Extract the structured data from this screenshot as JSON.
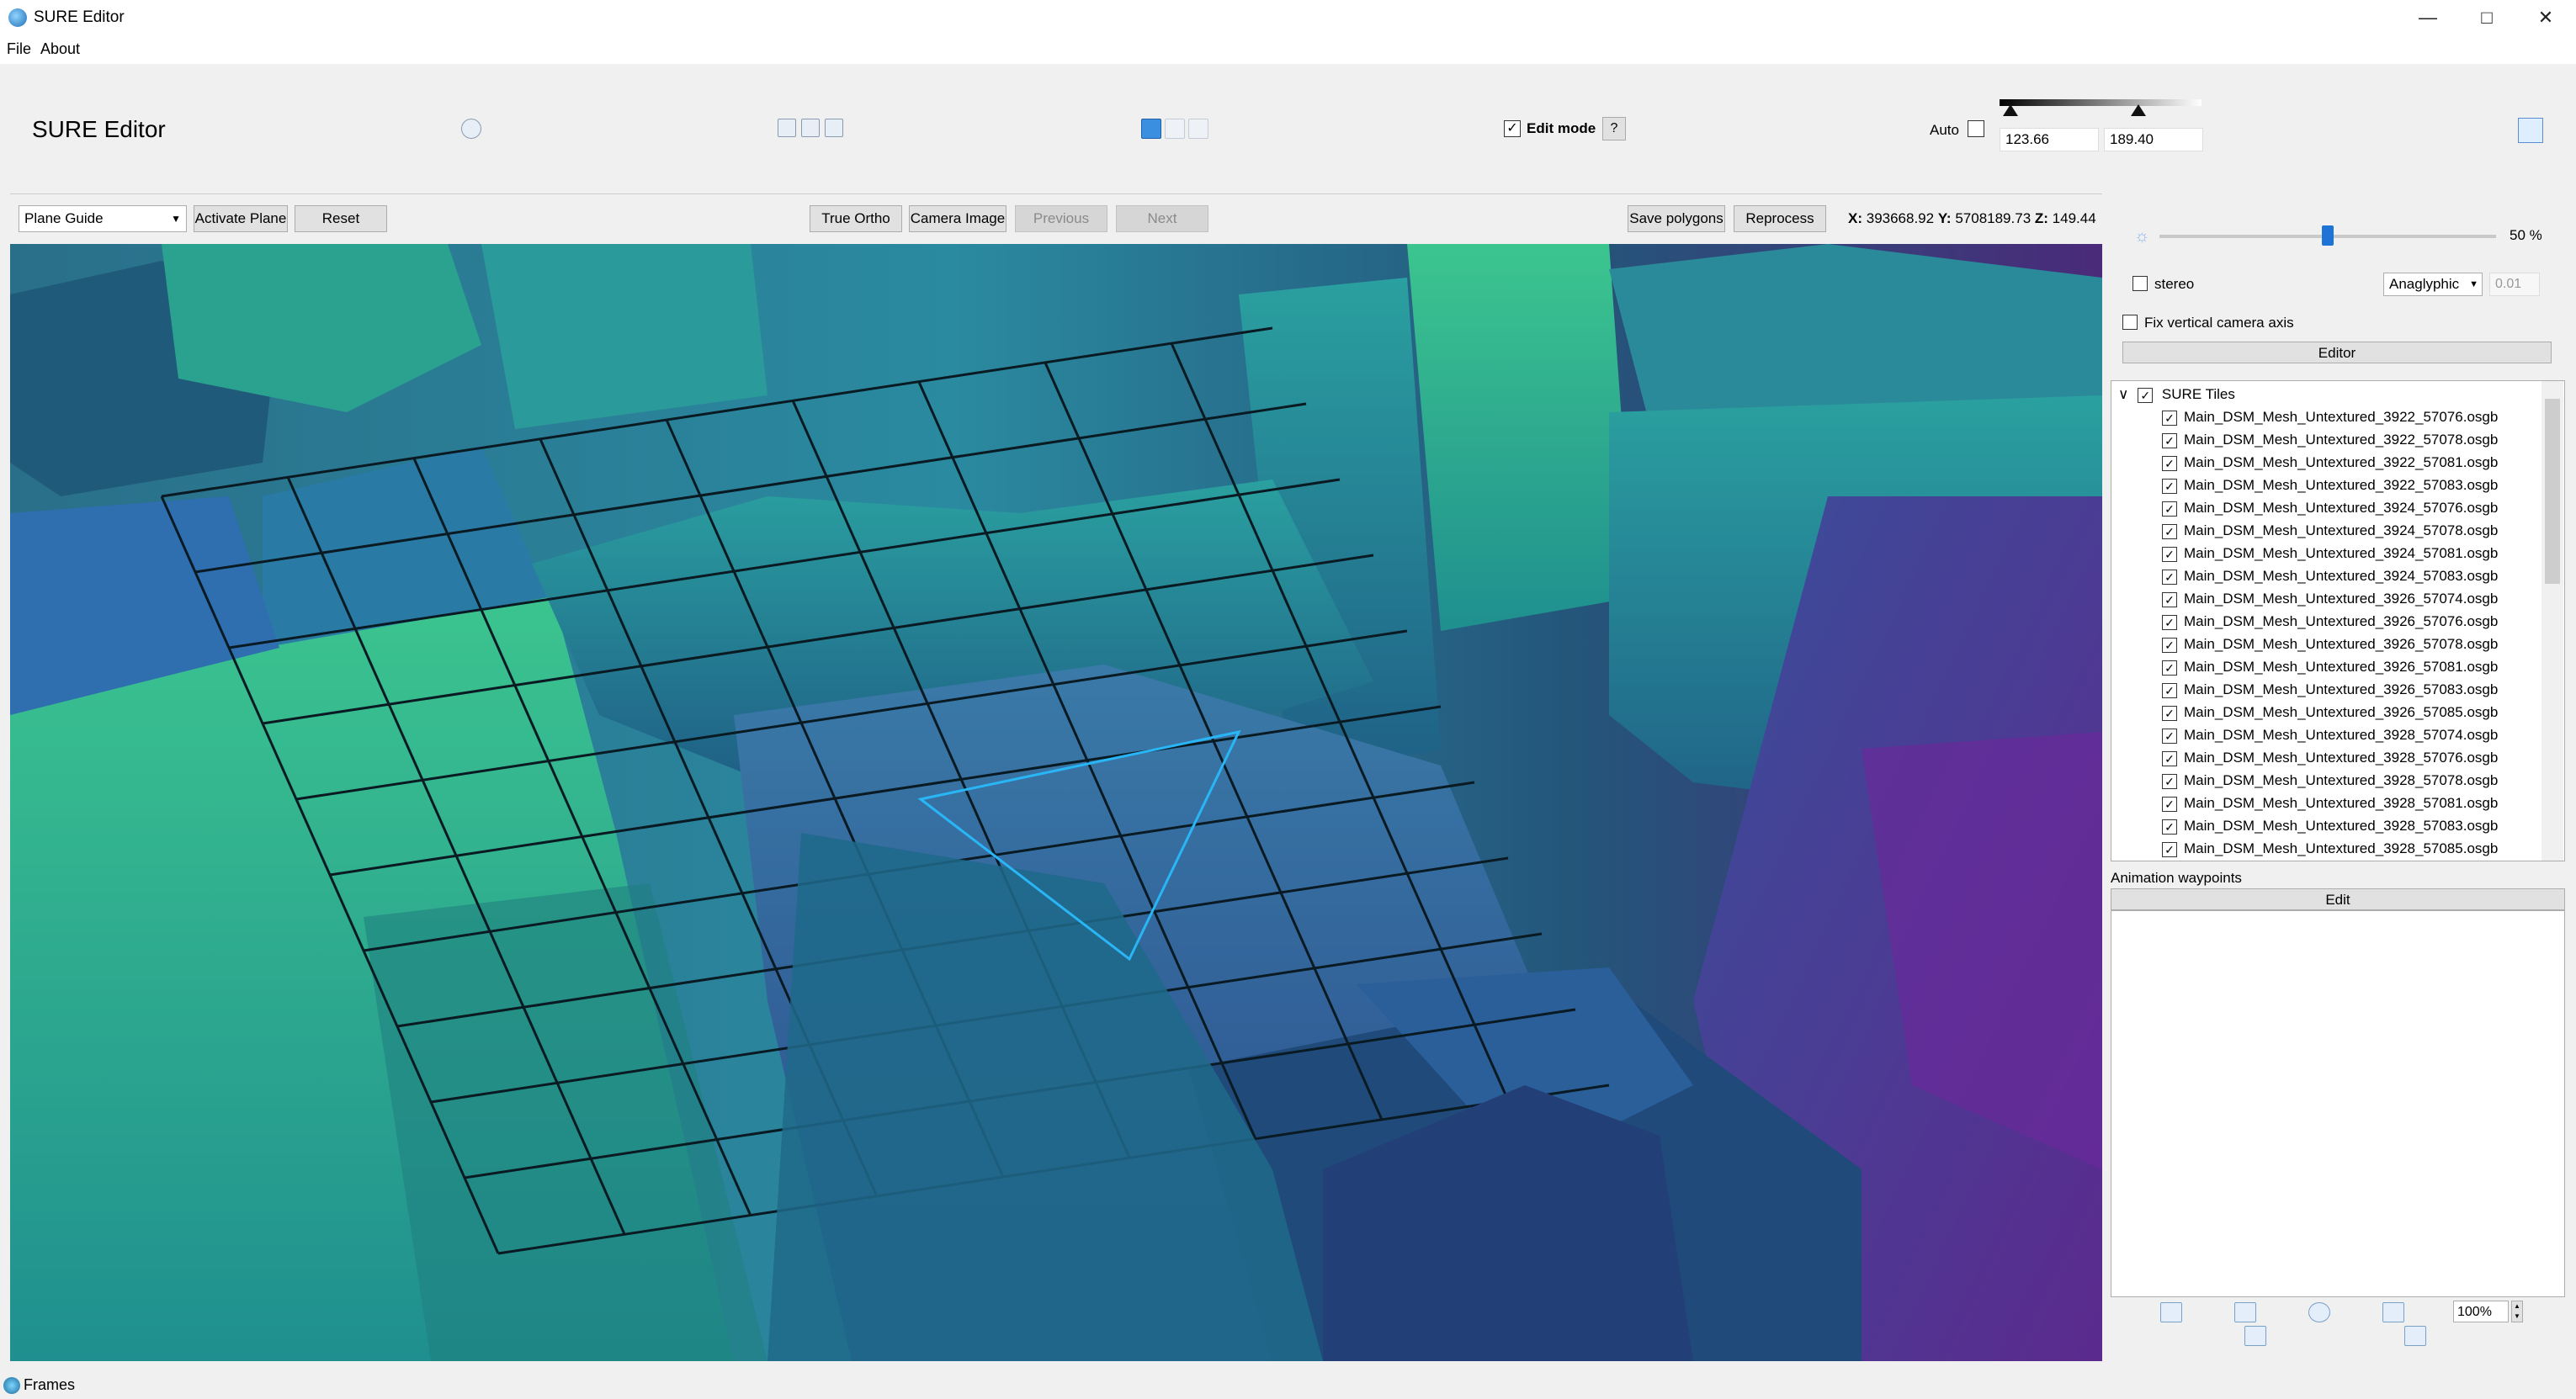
{
  "window": {
    "title": "SURE Editor",
    "minimize_icon": "minimize-icon",
    "maximize_icon": "maximize-icon",
    "close_icon": "close-icon"
  },
  "menu": {
    "items": [
      "File",
      "About"
    ]
  },
  "header": {
    "title": "SURE Editor",
    "help_icon": "help-icon",
    "edit_mode_label": "Edit mode",
    "edit_mode_checked": true,
    "edit_help_label": "?",
    "auto_label": "Auto",
    "auto_checked": false,
    "range_min": "123.66",
    "range_max": "189.40"
  },
  "viewer_toolbar": {
    "guide_select": "Plane Guide",
    "activate_plane": "Activate Plane",
    "reset": "Reset",
    "true_ortho": "True Ortho",
    "camera_image": "Camera Image",
    "previous": "Previous",
    "next": "Next",
    "save_polygons": "Save polygons",
    "reprocess": "Reprocess",
    "coords": {
      "x_label": "X:",
      "x": "393668.92",
      "y_label": "Y:",
      "y": "5708189.73",
      "z_label": "Z:",
      "z": "149.44"
    }
  },
  "right_panel": {
    "brightness_value": "50 %",
    "brightness_level": 0.5,
    "stereo_label": "stereo",
    "stereo_checked": false,
    "stereo_mode": "Anaglyphic",
    "stereo_offset": "0.01",
    "fix_axis_label": "Fix vertical camera axis",
    "fix_axis_checked": false,
    "editor_dropdown": "Editor",
    "tree": {
      "root": "SURE Tiles",
      "items": [
        "Main_DSM_Mesh_Untextured_3922_57076.osgb",
        "Main_DSM_Mesh_Untextured_3922_57078.osgb",
        "Main_DSM_Mesh_Untextured_3922_57081.osgb",
        "Main_DSM_Mesh_Untextured_3922_57083.osgb",
        "Main_DSM_Mesh_Untextured_3924_57076.osgb",
        "Main_DSM_Mesh_Untextured_3924_57078.osgb",
        "Main_DSM_Mesh_Untextured_3924_57081.osgb",
        "Main_DSM_Mesh_Untextured_3924_57083.osgb",
        "Main_DSM_Mesh_Untextured_3926_57074.osgb",
        "Main_DSM_Mesh_Untextured_3926_57076.osgb",
        "Main_DSM_Mesh_Untextured_3926_57078.osgb",
        "Main_DSM_Mesh_Untextured_3926_57081.osgb",
        "Main_DSM_Mesh_Untextured_3926_57083.osgb",
        "Main_DSM_Mesh_Untextured_3926_57085.osgb",
        "Main_DSM_Mesh_Untextured_3928_57074.osgb",
        "Main_DSM_Mesh_Untextured_3928_57076.osgb",
        "Main_DSM_Mesh_Untextured_3928_57078.osgb",
        "Main_DSM_Mesh_Untextured_3928_57081.osgb",
        "Main_DSM_Mesh_Untextured_3928_57083.osgb",
        "Main_DSM_Mesh_Untextured_3928_57085.osgb"
      ]
    },
    "animation_label": "Animation waypoints",
    "animation_edit": "Edit",
    "zoom": "100%"
  },
  "status": {
    "label": "Frames"
  },
  "colors": {
    "accent": "#1e74d6",
    "mesh_green": "#2fb88a",
    "mesh_teal": "#2a8fa3",
    "mesh_purple": "#5a2a8f",
    "selection": "#29b6f6"
  }
}
